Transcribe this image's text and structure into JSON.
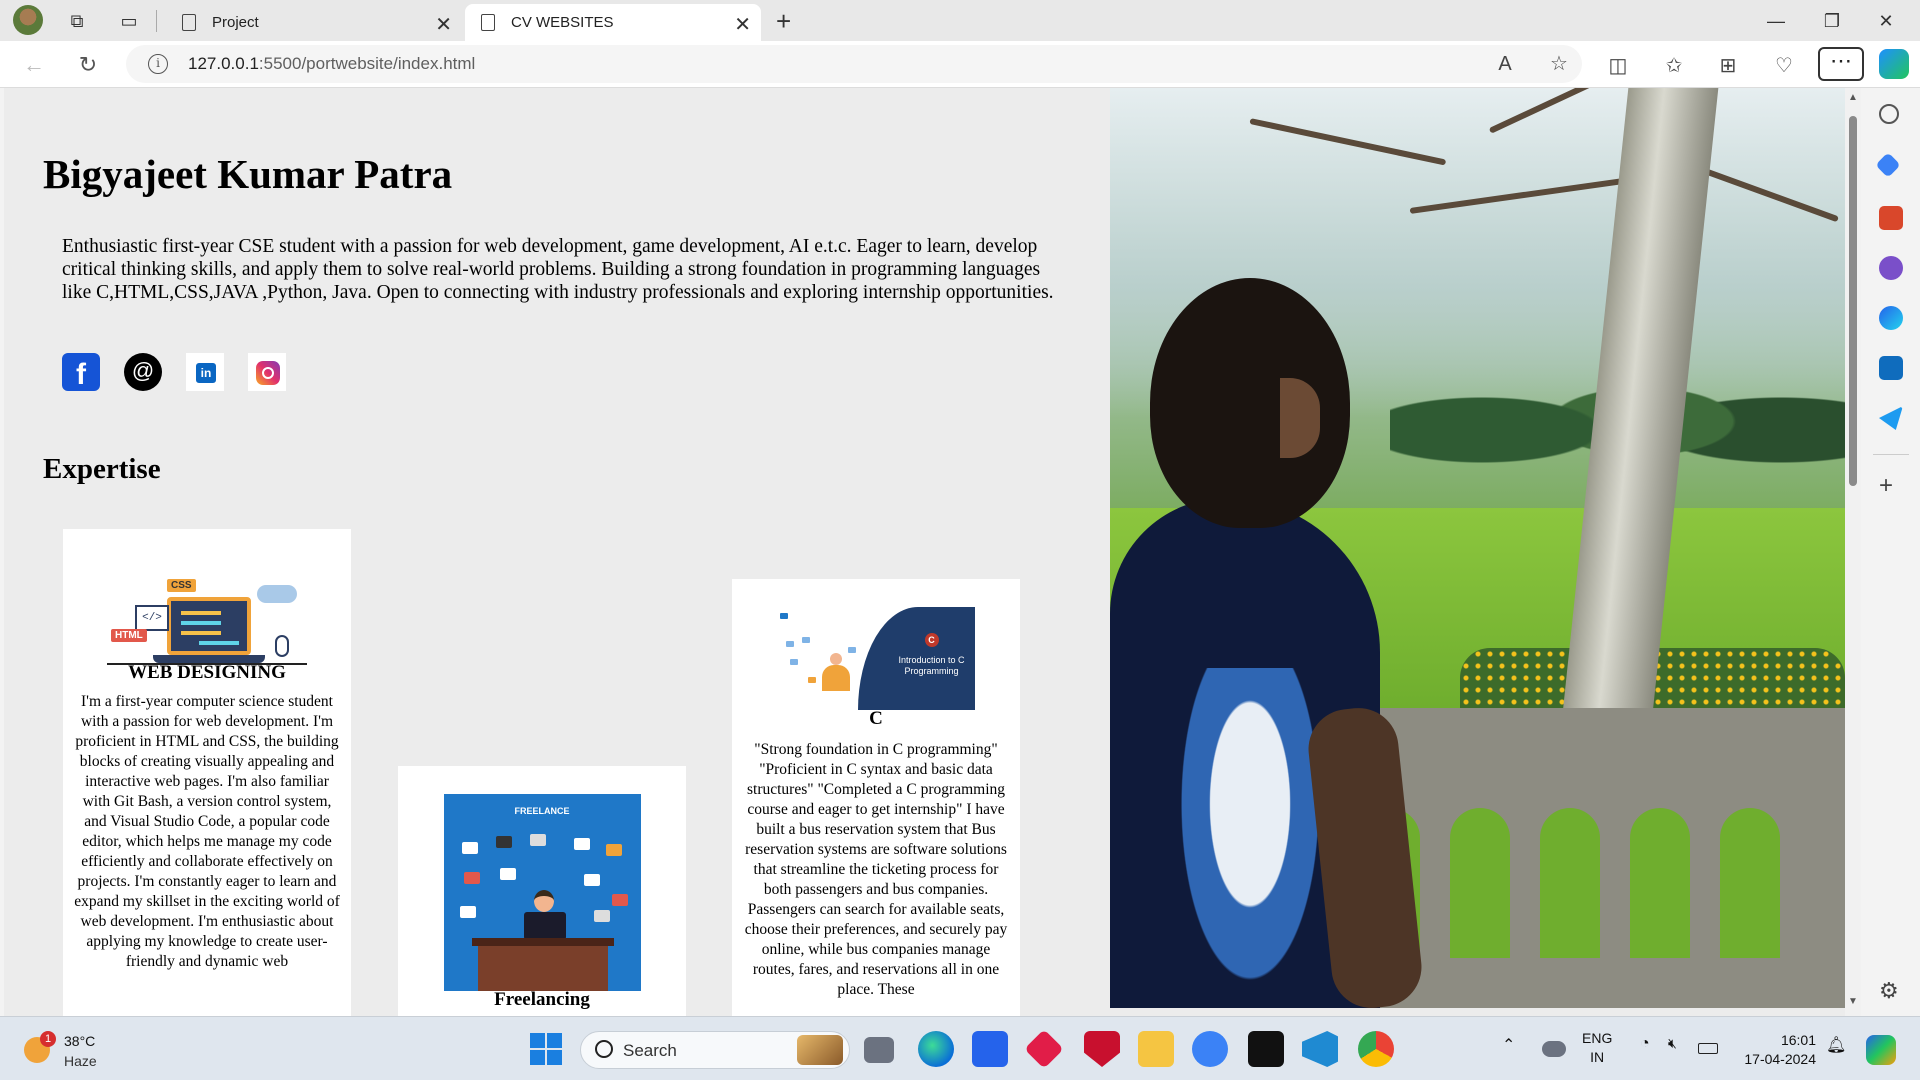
{
  "browser": {
    "tabs": [
      {
        "title": "Project",
        "active": false
      },
      {
        "title": "CV WEBSITES",
        "active": true
      }
    ],
    "url_host": "127.0.0.1",
    "url_rest": ":5500/portwebsite/index.html"
  },
  "page": {
    "name": "Bigyajeet Kumar Patra",
    "about": "Enthusiastic first-year CSE student with a passion for web development, game development, AI e.t.c. Eager to learn, develop critical thinking skills, and apply them to solve real-world problems. Building a strong foundation in programming languages like C,HTML,CSS,JAVA ,Python, Java. Open to connecting with industry professionals and exploring internship opportunities.",
    "social": [
      "facebook-icon",
      "threads-icon",
      "linkedin-icon",
      "instagram-icon"
    ],
    "expertise_heading": "Expertise",
    "cards": {
      "web": {
        "title": "WEB DESIGNING",
        "body": "I'm a first-year computer science student with a passion for web development. I'm proficient in HTML and CSS, the building blocks of creating visually appealing and interactive web pages. I'm also familiar with Git Bash, a version control system, and Visual Studio Code, a popular code editor, which helps me manage my code efficiently and collaborate effectively on projects. I'm constantly eager to learn and expand my skillset in the exciting world of web development. I'm enthusiastic about applying my knowledge to create user-friendly and dynamic web",
        "illus_tags": [
          "HTML",
          "CSS",
          "</>"
        ]
      },
      "freelance": {
        "title": "Freelancing",
        "illus_header": "FREELANCE"
      },
      "c": {
        "title": "C",
        "body": "\"Strong foundation in C programming\" \"Proficient in C syntax and basic data structures\" \"Completed a C programming course and eager to get internship\" I have built a bus reservation system that Bus reservation systems are software solutions that streamline the ticketing process for both passengers and bus companies. Passengers can search for available seats, choose their preferences, and securely pay online, while bus companies manage routes, fares, and reservations all in one place. These",
        "illus_logo": "C",
        "illus_text": "Introduction to C Programming"
      }
    }
  },
  "taskbar": {
    "weather_temp": "38°C",
    "weather_cond": "Haze",
    "weather_badge": "1",
    "search_label": "Search",
    "lang_line1": "ENG",
    "lang_line2": "IN",
    "time": "16:01",
    "date": "17-04-2024"
  },
  "colors": {
    "page_bg": "#ececec",
    "card_bg": "#ffffff",
    "taskbar_bg": "#dfe6ee"
  }
}
